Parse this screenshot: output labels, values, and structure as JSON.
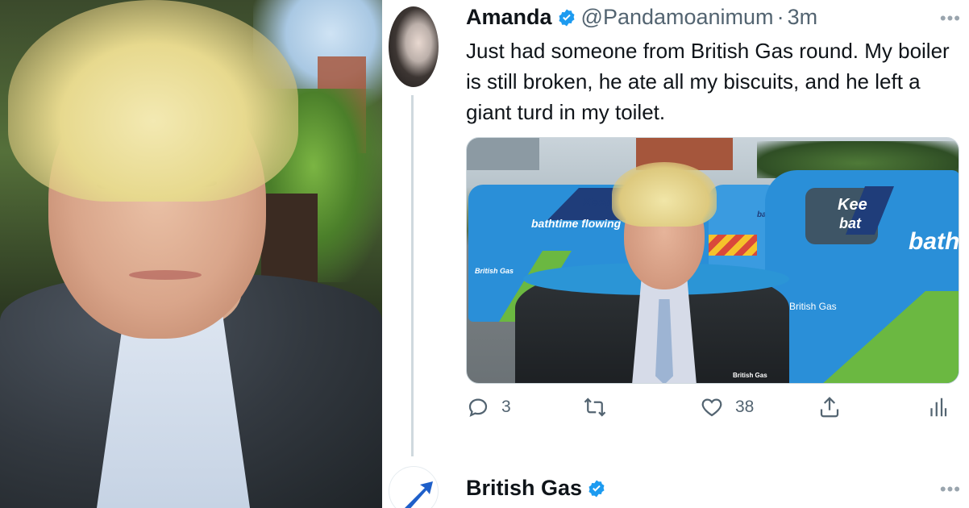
{
  "colors": {
    "text_primary": "#0f1419",
    "text_secondary": "#536471",
    "verified_blue": "#1d9bf0",
    "divider": "#cfd9de",
    "van_blue": "#2a8fd8",
    "van_navy": "#1f3d7a",
    "van_green": "#6bb841"
  },
  "left_photo": {
    "icon": "person-selfie-photo"
  },
  "tweet": {
    "display_name": "Amanda",
    "handle": "@Pandamoanimum",
    "separator": "·",
    "time": "3m",
    "text": "Just had someone from British Gas round. My boiler is still broken, he ate all my biscuits, and he left a giant turd in my toilet.",
    "media": {
      "van_slogan_line1": "Keeping",
      "van_slogan_line2": "bathtime flowing",
      "van_right_text_1": "Kee",
      "van_right_text_2": "bat",
      "van_right_text_3": "bath",
      "van_brand": "British Gas",
      "van_small_text": "bathtime",
      "coat_badge": "British Gas"
    },
    "actions": {
      "reply_count": "3",
      "retweet_count": "",
      "like_count": "38",
      "share_icon": "share-icon",
      "analytics_icon": "analytics-icon"
    }
  },
  "reply": {
    "display_name": "British Gas"
  }
}
